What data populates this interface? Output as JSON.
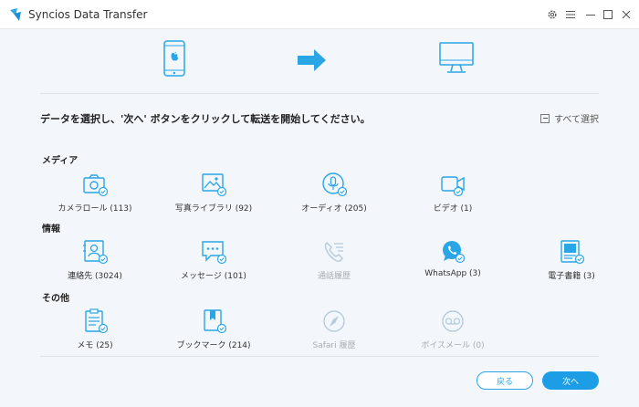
{
  "window": {
    "title": "Syncios Data Transfer"
  },
  "header": {
    "instruction": "データを選択し、'次へ' ボタンをクリックして転送を開始してください。",
    "select_all_label": "すべて選択"
  },
  "sections": {
    "media": {
      "title": "メディア",
      "items": [
        {
          "label": "カメラロール (113)",
          "icon": "camera-icon",
          "enabled": true,
          "checked": true
        },
        {
          "label": "写真ライブラリ (92)",
          "icon": "photo-library-icon",
          "enabled": true,
          "checked": true
        },
        {
          "label": "オーディオ (205)",
          "icon": "audio-icon",
          "enabled": true,
          "checked": true
        },
        {
          "label": "ビデオ (1)",
          "icon": "video-icon",
          "enabled": true,
          "checked": true
        }
      ]
    },
    "info": {
      "title": "情報",
      "items": [
        {
          "label": "連絡先 (3024)",
          "icon": "contacts-icon",
          "enabled": true,
          "checked": true
        },
        {
          "label": "メッセージ (101)",
          "icon": "messages-icon",
          "enabled": true,
          "checked": true
        },
        {
          "label": "通話履歴",
          "icon": "call-history-icon",
          "enabled": false,
          "checked": false
        },
        {
          "label": "WhatsApp (3)",
          "icon": "whatsapp-icon",
          "enabled": true,
          "checked": true
        },
        {
          "label": "電子書籍 (3)",
          "icon": "ebook-icon",
          "enabled": true,
          "checked": true
        }
      ]
    },
    "other": {
      "title": "その他",
      "items": [
        {
          "label": "メモ (25)",
          "icon": "notes-icon",
          "enabled": true,
          "checked": true
        },
        {
          "label": "ブックマーク (214)",
          "icon": "bookmark-icon",
          "enabled": true,
          "checked": true
        },
        {
          "label": "Safari 履歴",
          "icon": "safari-icon",
          "enabled": false,
          "checked": false
        },
        {
          "label": "ボイスメール (0)",
          "icon": "voicemail-icon",
          "enabled": false,
          "checked": false
        }
      ]
    }
  },
  "footer": {
    "back_label": "戻る",
    "next_label": "次へ"
  },
  "colors": {
    "accent": "#2aa5e6",
    "icon_enabled": "#2aa5e6",
    "icon_disabled": "#b5cbdc",
    "primary_button": "#1c9de5"
  }
}
